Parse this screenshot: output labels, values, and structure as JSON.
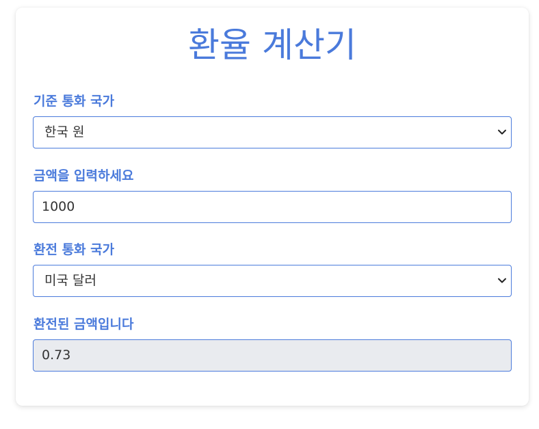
{
  "page": {
    "title": "환율 계산기"
  },
  "base_currency": {
    "label": "기준 통화 국가",
    "selected": "한국 원"
  },
  "amount": {
    "label": "금액을 입력하세요",
    "value": "1000"
  },
  "target_currency": {
    "label": "환전 통화 국가",
    "selected": "미국 달러"
  },
  "result": {
    "label": "환전된 금액입니다",
    "value": "0.73"
  },
  "icons": {
    "select_arrow": "chevron-down-icon"
  },
  "colors": {
    "accent": "#4a7adb",
    "readonly_bg": "#e9ebef"
  }
}
